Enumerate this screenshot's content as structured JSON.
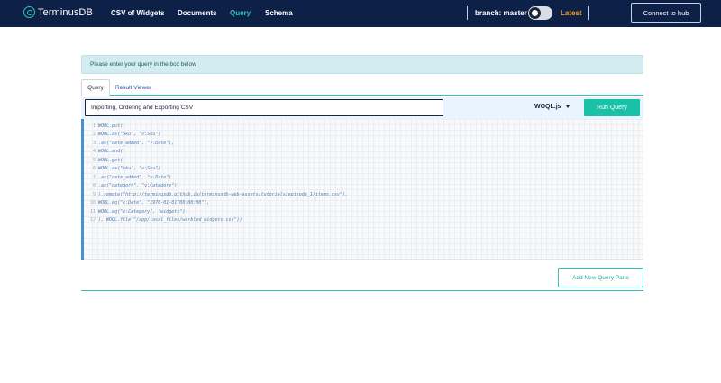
{
  "nav": {
    "logo_text": "TerminusDB",
    "items": [
      {
        "label": "CSV of Widgets",
        "active": false
      },
      {
        "label": "Documents",
        "active": false
      },
      {
        "label": "Query",
        "active": true
      },
      {
        "label": "Schema",
        "active": false
      }
    ],
    "branch_label": "branch: master",
    "branch_toggle": "off",
    "latest_label": "Latest",
    "connect_button": "Connect to hub"
  },
  "alert": {
    "text": "Please enter your query in the box below"
  },
  "tabs": [
    {
      "label": "Query",
      "active": true
    },
    {
      "label": "Result Viewer",
      "active": false
    }
  ],
  "query_bar": {
    "title_value": "Importing, Ordering and Exporting CSV",
    "language": "WOQL.js",
    "run_button": "Run Query"
  },
  "editor": {
    "lines": [
      {
        "num": "1",
        "code": "WOQL.put("
      },
      {
        "num": "2",
        "code": "WOQL.as(\"Sku\", \"v:Sku\")"
      },
      {
        "num": "3",
        "code": ".as(\"date_added\", \"v:Date\"),"
      },
      {
        "num": "4",
        "code": "WOQL.and("
      },
      {
        "num": "5",
        "code": "WOQL.get("
      },
      {
        "num": "6",
        "code": "WOQL.as(\"sku\", \"v:Sku\")"
      },
      {
        "num": "7",
        "code": ".as(\"date_added\", \"v:Date\")"
      },
      {
        "num": "8",
        "code": ".as(\"category\", \"v:Category\")"
      },
      {
        "num": "9",
        "code": ").remote(\"http://terminusdb.github.io/terminusdb-web-assets/tutorials/episode_1/items.csv\"),"
      },
      {
        "num": "10",
        "code": "WOQL.eq(\"v:Date\", \"1970-01-01T00:00:00\"),"
      },
      {
        "num": "11",
        "code": "WOQL.eq(\"v:Category\", \"widgets\")"
      },
      {
        "num": "12",
        "code": "), WOQL.file(\"/app/local_files/warbled_widgets.csv\"))"
      }
    ]
  },
  "add_pane_button": "Add New Query Pane",
  "colors": {
    "navbar_bg": "#0d2048",
    "accent_teal": "#2fc4b6",
    "run_button_bg": "#19c1a6",
    "latest_orange": "#f29f22",
    "alert_bg": "#d3ecf0",
    "query_bar_bg": "#eaf4ff"
  }
}
